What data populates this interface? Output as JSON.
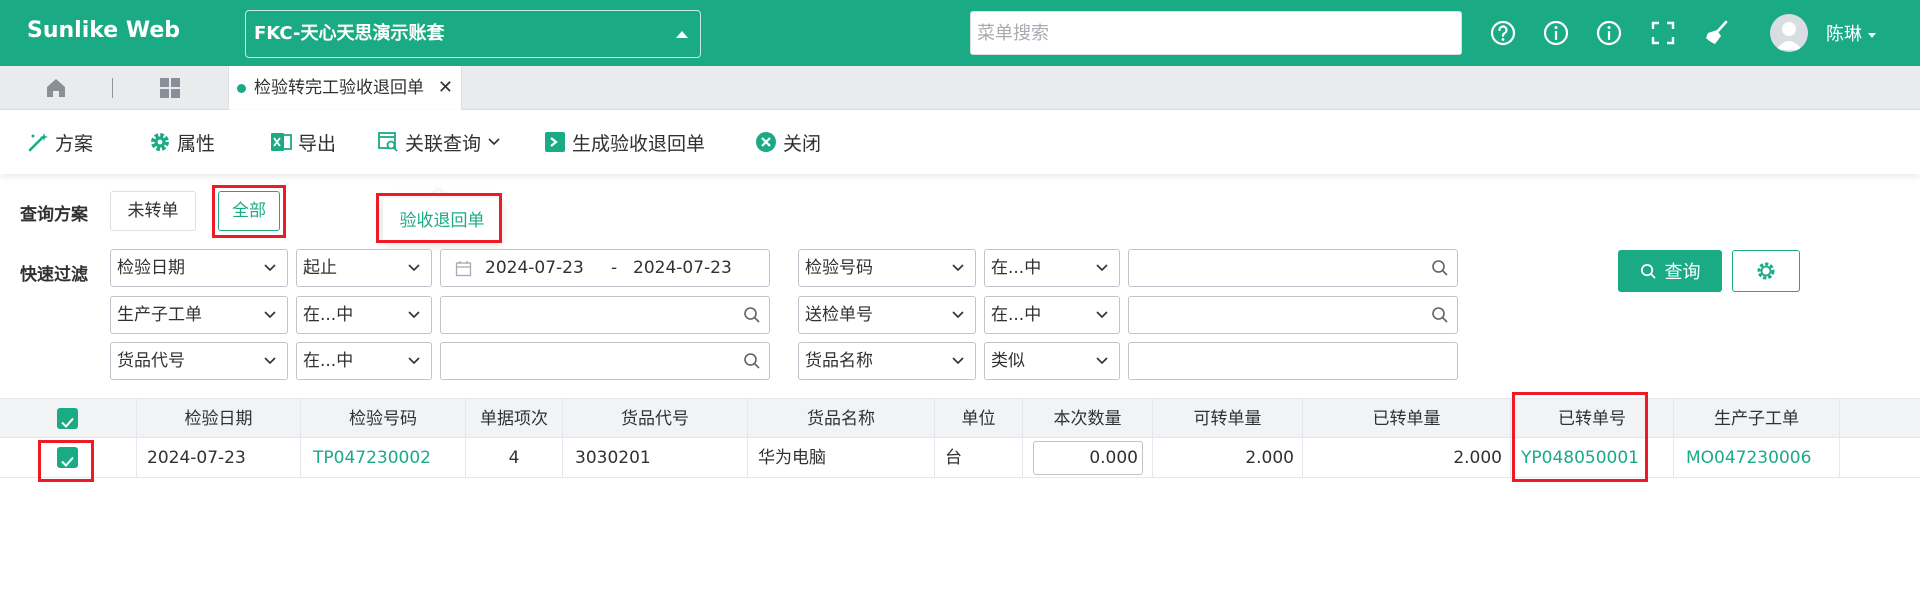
{
  "header": {
    "brand": "Sunlike Web",
    "account": "FKC-天心天思演示账套",
    "search_placeholder": "菜单搜索",
    "username": "陈琳",
    "icons": [
      "help-circle-icon",
      "info-icon",
      "info-icon",
      "fullscreen-icon",
      "broom-icon"
    ]
  },
  "tabs": {
    "active_label": "检验转完工验收退回单",
    "close_glyph": "✕"
  },
  "toolbar": {
    "plan": "方案",
    "attributes": "属性",
    "export": "导出",
    "related_query": "关联查询",
    "generate": "生成验收退回单",
    "close": "关闭"
  },
  "popup": {
    "item": "验收退回单"
  },
  "query": {
    "plan_label": "查询方案",
    "plan_untransferred": "未转单",
    "plan_all": "全部",
    "filter_label": "快速过滤",
    "rows": [
      {
        "left_field": "检验日期",
        "left_op": "起止",
        "date_from": "2024-07-23",
        "date_sep": "-",
        "date_to": "2024-07-23",
        "right_field": "检验号码",
        "right_op": "在...中"
      },
      {
        "left_field": "生产子工单",
        "left_op": "在...中",
        "right_field": "送检单号",
        "right_op": "在...中"
      },
      {
        "left_field": "货品代号",
        "left_op": "在...中",
        "right_field": "货品名称",
        "right_op": "类似"
      }
    ],
    "query_button": "查询"
  },
  "table": {
    "columns": [
      "检验日期",
      "检验号码",
      "单据项次",
      "货品代号",
      "货品名称",
      "单位",
      "本次数量",
      "可转单量",
      "已转单量",
      "已转单号",
      "生产子工单"
    ],
    "rows": [
      {
        "date": "2024-07-23",
        "inspection_no": "TP047230002",
        "item_no": "4",
        "product_code": "3030201",
        "product_name": "华为电脑",
        "unit": "台",
        "qty": "0.000",
        "convertible": "2.000",
        "converted": "2.000",
        "converted_no": "YP048050001",
        "work_order": "MO047230006",
        "checked": true
      }
    ]
  },
  "colors": {
    "brand": "#1aab85",
    "highlight": "#ee1b24"
  }
}
